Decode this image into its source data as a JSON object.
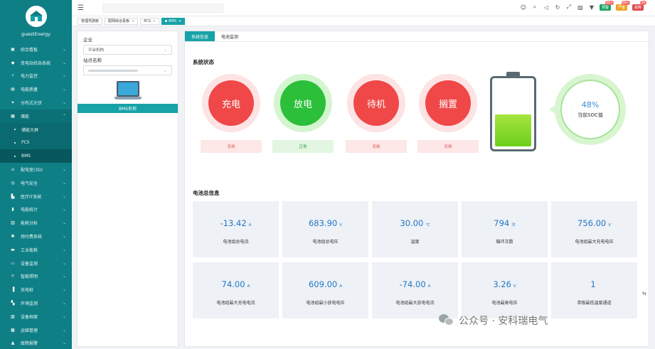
{
  "sidebar": {
    "company": "guestEnergy",
    "items": [
      {
        "label": "综合看板",
        "icon": "▣"
      },
      {
        "label": "变电站综自系统",
        "icon": "◆"
      },
      {
        "label": "电力监控",
        "icon": "⚡"
      },
      {
        "label": "电能质量",
        "icon": "▤"
      },
      {
        "label": "分布式光伏",
        "icon": "✦"
      },
      {
        "label": "储能",
        "icon": "▦"
      }
    ],
    "subitems": [
      {
        "label": "储能大屏"
      },
      {
        "label": "PCS"
      },
      {
        "label": "BMS"
      }
    ],
    "items2": [
      {
        "label": "配电室(3D)",
        "icon": "⌂"
      },
      {
        "label": "电气安全",
        "icon": "◎"
      },
      {
        "label": "医疗IT系统",
        "icon": "▙"
      },
      {
        "label": "电能统计",
        "icon": "▮"
      },
      {
        "label": "能耗分析",
        "icon": "▥"
      },
      {
        "label": "预付费系统",
        "icon": "✱"
      },
      {
        "label": "工业能耗",
        "icon": "▬"
      },
      {
        "label": "设备监测",
        "icon": "▭"
      },
      {
        "label": "智能照明",
        "icon": "☼"
      },
      {
        "label": "充电桩",
        "icon": "▐"
      },
      {
        "label": "环境监测",
        "icon": "▚"
      },
      {
        "label": "设备档案",
        "icon": "▧"
      },
      {
        "label": "运维管理",
        "icon": "▩"
      },
      {
        "label": "故障报警",
        "icon": "▲"
      }
    ]
  },
  "topbar": {
    "pills": [
      {
        "label": "预警",
        "badge": "99+",
        "color": "#1aa260"
      },
      {
        "label": "严重",
        "badge": "99+",
        "color": "#f0a020"
      },
      {
        "label": "故障",
        "badge": "20",
        "color": "#e04848"
      }
    ]
  },
  "tabs": [
    {
      "label": "管理驾驶舱",
      "active": false,
      "closable": false
    },
    {
      "label": "配网综合看板",
      "active": false,
      "closable": true
    },
    {
      "label": "PCS",
      "active": false,
      "closable": true
    },
    {
      "label": "BMS",
      "active": true,
      "closable": true
    }
  ],
  "left_panel": {
    "company_label": "企业",
    "company_value": "平台机构",
    "station_label": "站点名称",
    "bms_label": "BMS名称"
  },
  "main": {
    "tabs": [
      "系统信息",
      "电池监测"
    ],
    "status_title": "系统状态",
    "statuses": [
      {
        "label": "充电",
        "tag": "无效",
        "active": false
      },
      {
        "label": "放电",
        "tag": "正常",
        "active": true
      },
      {
        "label": "待机",
        "tag": "无效",
        "active": false
      },
      {
        "label": "搁置",
        "tag": "无效",
        "active": false
      }
    ],
    "soc_value": "48%",
    "soc_fraction": 0.48,
    "soc_label": "当前SOC值",
    "info_title": "电池总信息",
    "cards": [
      {
        "value": "-13.42",
        "unit": "A",
        "label": "电池组总电流"
      },
      {
        "value": "683.90",
        "unit": "V",
        "label": "电池组总电压"
      },
      {
        "value": "30.00",
        "unit": "℃",
        "label": "温度"
      },
      {
        "value": "794",
        "unit": "次",
        "label": "循环次数"
      },
      {
        "value": "756.00",
        "unit": "V",
        "label": "电池组最大充电电压"
      },
      {
        "value": "74.00",
        "unit": "A",
        "label": "电池组最大充电电流"
      },
      {
        "value": "609.00",
        "unit": "A",
        "label": "电池组最小放电电压"
      },
      {
        "value": "-74.00",
        "unit": "A",
        "label": "电池组最大放电电流"
      },
      {
        "value": "3.26",
        "unit": "V",
        "label": "电池最高电压"
      },
      {
        "value": "1",
        "unit": "",
        "label": "单板最低温度通道"
      }
    ]
  },
  "watermark": "公众号 · 安科瑞电气",
  "colors": {
    "sidebar": "#0f7f86",
    "accent": "#17a2a8",
    "red": "#f04848",
    "green": "#2bbf3a"
  }
}
